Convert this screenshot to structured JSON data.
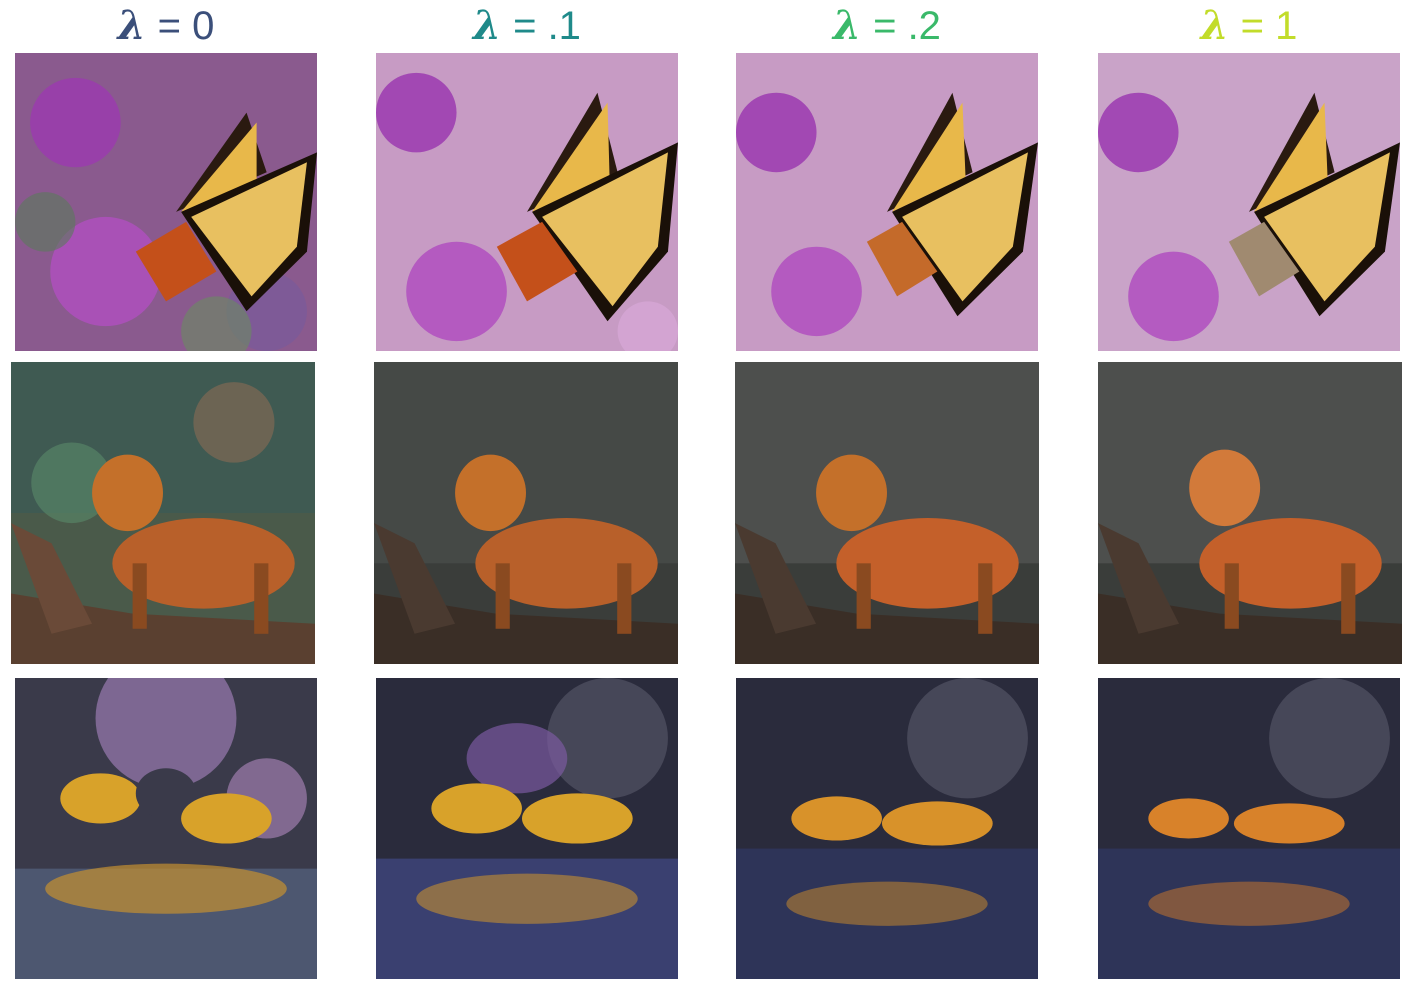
{
  "columns": [
    {
      "lambda_symbol": "λ",
      "label": "= 0",
      "color": "#3b4f7a"
    },
    {
      "lambda_symbol": "λ",
      "label": "= .1",
      "color": "#1f8a8a"
    },
    {
      "lambda_symbol": "λ",
      "label": "= .2",
      "color": "#3ab96a"
    },
    {
      "lambda_symbol": "λ",
      "label": "= 1",
      "color": "#c2dc2a"
    }
  ],
  "rows": [
    {
      "subject": "butterfly-on-purple-flowers",
      "palette": {
        "bg": "#c79bc4",
        "accent": "#9b3ab0",
        "subject": "#e8b84a"
      }
    },
    {
      "subject": "big-cat-on-branch",
      "palette": {
        "bg": "#3a3d3a",
        "accent": "#8a6a55",
        "subject": "#c4602a"
      }
    },
    {
      "subject": "insects-with-reflection",
      "palette": {
        "bg": "#2a2b3c",
        "accent": "#5a4a8a",
        "subject": "#d8a22a"
      }
    }
  ]
}
